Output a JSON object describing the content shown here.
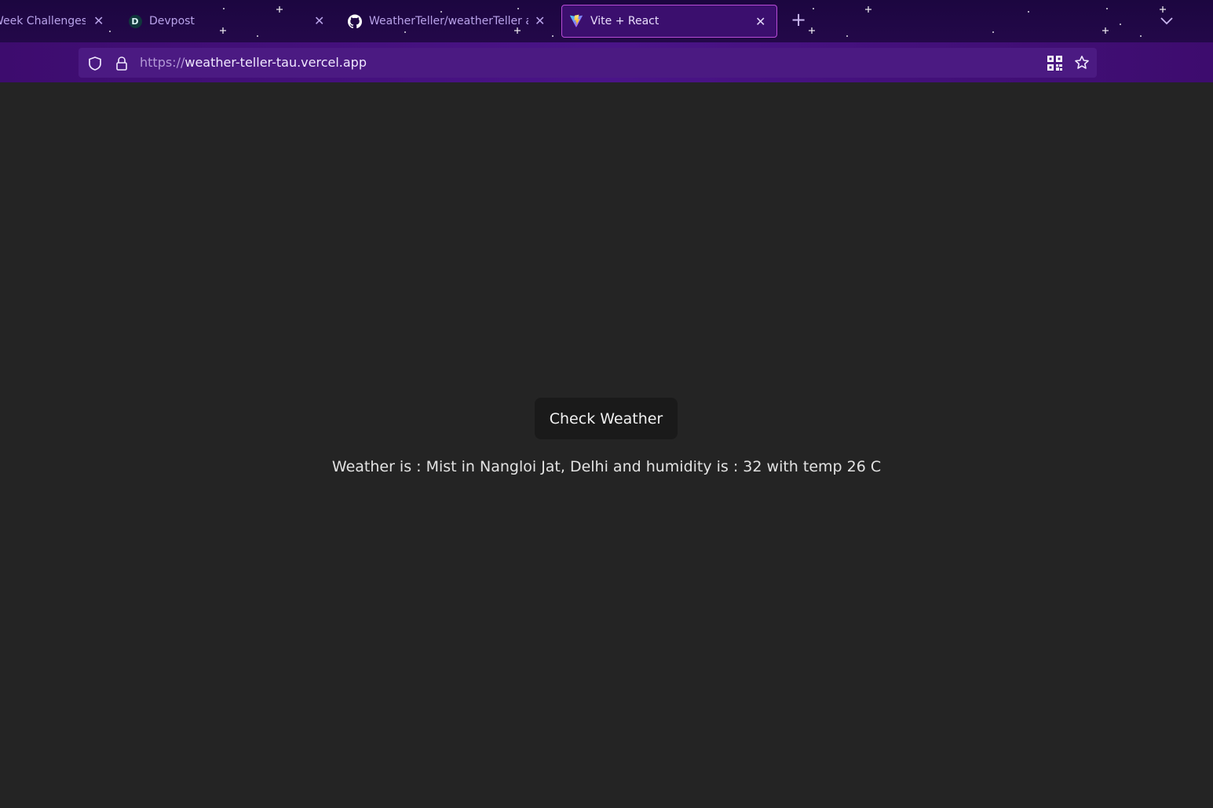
{
  "browser": {
    "tabs": [
      {
        "label": "Week Challenges",
        "icon": "none",
        "active": false
      },
      {
        "label": "Devpost",
        "icon": "devpost-icon",
        "active": false
      },
      {
        "label": "WeatherTeller/weatherTeller at",
        "icon": "github-icon",
        "active": false
      },
      {
        "label": "Vite + React",
        "icon": "vite-icon",
        "active": true
      }
    ],
    "close_glyph": "✕",
    "new_tab_glyph": "+",
    "url_scheme": "https://",
    "url_host": "weather-teller-tau.vercel.app",
    "theme_colors": {
      "chrome": "#230849",
      "urlbar": "#4b1a82",
      "active_tab_border": "#b84cd6"
    }
  },
  "page": {
    "check_button_label": "Check Weather",
    "result_text": "Weather is : Mist in Nangloi Jat, Delhi and humidity is : 32 with temp 26 C",
    "background_color": "#242424"
  },
  "favicon_letters": {
    "devpost": "D"
  }
}
